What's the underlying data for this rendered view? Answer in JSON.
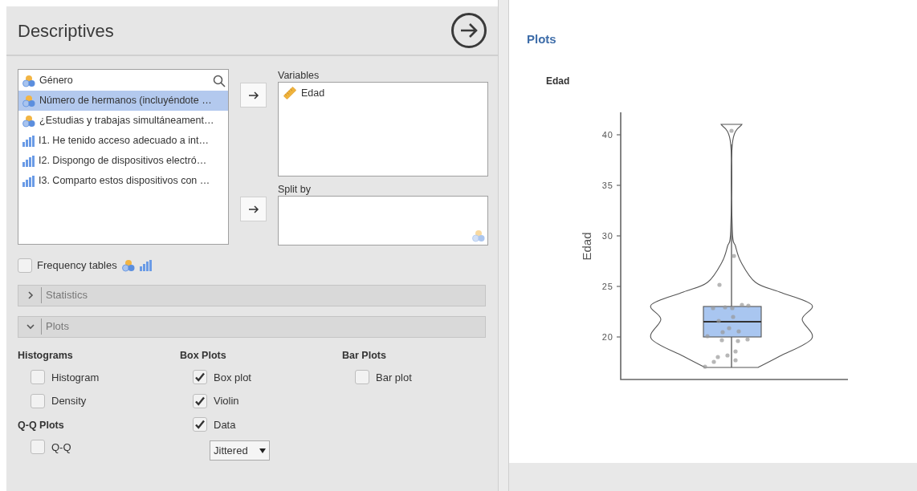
{
  "header": {
    "title": "Descriptives"
  },
  "source_list": {
    "items": [
      {
        "kind": "nominal",
        "label": "Género",
        "selected": false
      },
      {
        "kind": "nominal",
        "label": "Número de hermanos (incluyéndote …",
        "selected": true
      },
      {
        "kind": "nominal",
        "label": "¿Estudias y trabajas simultáneament…",
        "selected": false
      },
      {
        "kind": "ordinal",
        "label": "I1. He tenido acceso adecuado a int…",
        "selected": false
      },
      {
        "kind": "ordinal",
        "label": "I2. Dispongo de dispositivos electró…",
        "selected": false
      },
      {
        "kind": "ordinal",
        "label": "I3. Comparto estos dispositivos con …",
        "selected": false
      }
    ]
  },
  "variables": {
    "label": "Variables",
    "items": [
      {
        "kind": "continuous",
        "label": "Edad"
      }
    ]
  },
  "split_by": {
    "label": "Split by"
  },
  "frequency_tables": {
    "label": "Frequency tables",
    "checked": false
  },
  "sections": [
    {
      "label": "Statistics",
      "expanded": false
    },
    {
      "label": "Plots",
      "expanded": true
    }
  ],
  "plot_columns": [
    [
      {
        "heading": "Histograms",
        "options": [
          {
            "label": "Histogram",
            "checked": false
          },
          {
            "label": "Density",
            "checked": false
          }
        ]
      },
      {
        "heading": "Q-Q Plots",
        "options": [
          {
            "label": "Q-Q",
            "checked": false
          }
        ]
      }
    ],
    [
      {
        "heading": "Box Plots",
        "options": [
          {
            "label": "Box plot",
            "checked": true
          },
          {
            "label": "Violin",
            "checked": true
          },
          {
            "label": "Data",
            "checked": true
          }
        ],
        "select": {
          "value": "Jittered"
        }
      }
    ],
    [
      {
        "heading": "Bar Plots",
        "options": [
          {
            "label": "Bar plot",
            "checked": false
          }
        ]
      }
    ]
  ],
  "results": {
    "title": "Plots",
    "plot": {
      "title": "Edad",
      "ylabel": "Edad",
      "yticks": [
        "40",
        "35",
        "30",
        "25",
        "20"
      ]
    }
  }
}
